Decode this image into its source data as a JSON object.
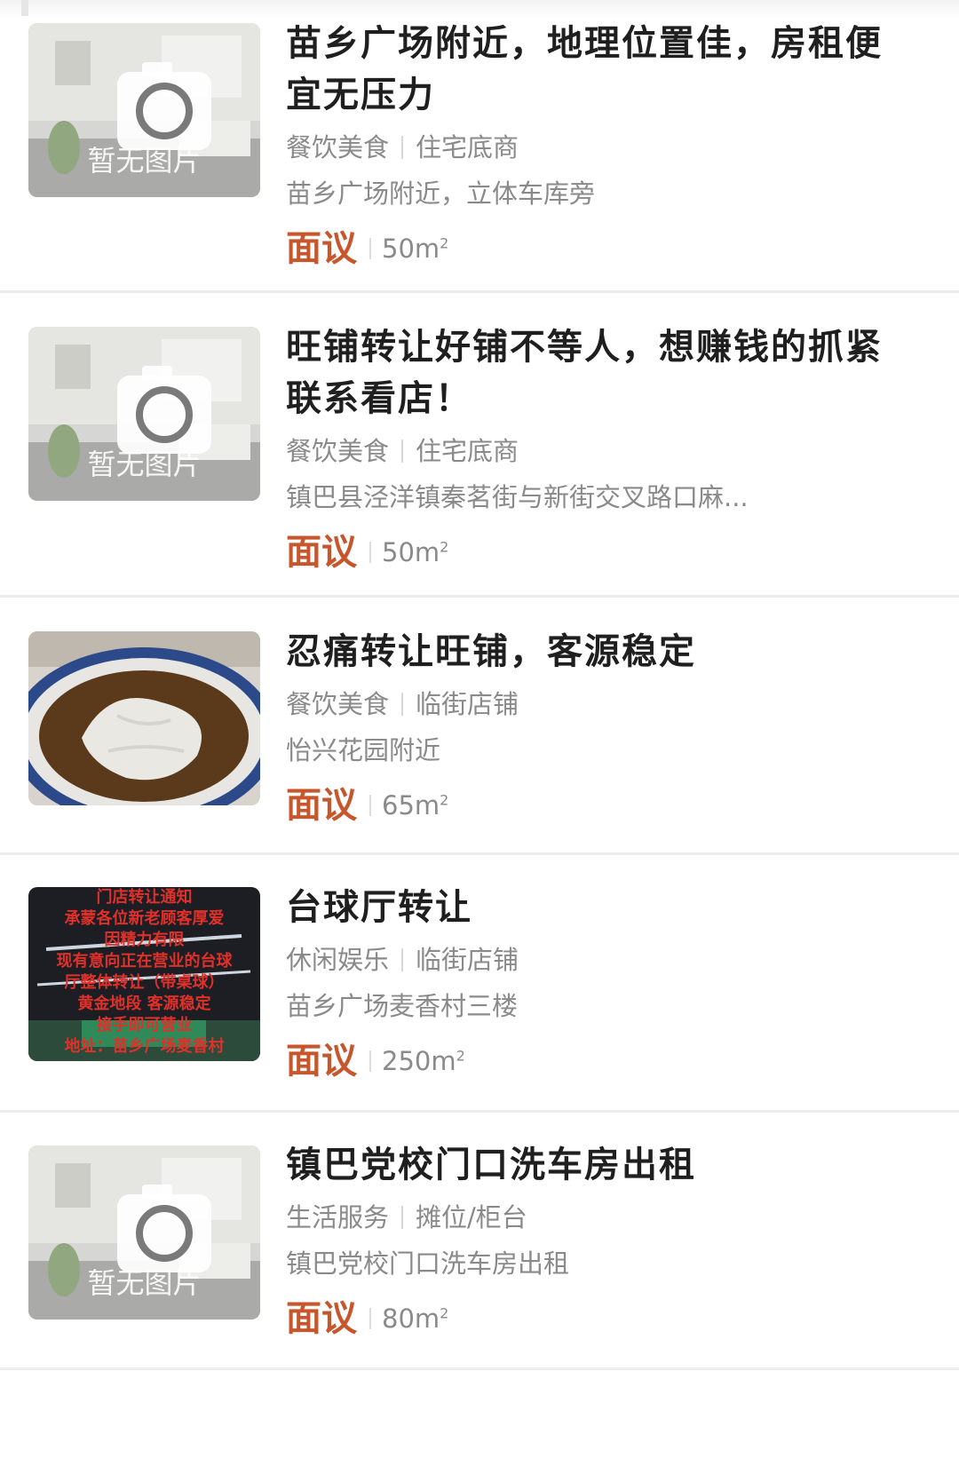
{
  "listings": [
    {
      "title": "苗乡广场附近，地理位置佳，房租便宜无压力",
      "title_line1": "苗乡广场附近，地理位置佳，房租便",
      "title_line2": "宜无压力",
      "category": "餐饮美食",
      "shop_type": "住宅底商",
      "address": "苗乡广场附近，立体车库旁",
      "price": "面议",
      "area_value": "50m",
      "area_sup": "2",
      "image": {
        "kind": "placeholder",
        "text": "暂无图片",
        "icon": "camera-icon"
      }
    },
    {
      "title": "旺铺转让好铺不等人，想赚钱的抓紧联系看店！",
      "title_line1": "旺铺转让好铺不等人，想赚钱的抓紧",
      "title_line2": "联系看店！",
      "category": "餐饮美食",
      "shop_type": "住宅底商",
      "address": "镇巴县泾洋镇秦茗街与新街交叉路口麻...",
      "price": "面议",
      "area_value": "50m",
      "area_sup": "2",
      "image": {
        "kind": "placeholder",
        "text": "暂无图片",
        "icon": "camera-icon"
      }
    },
    {
      "title": "忍痛转让旺铺，客源稳定",
      "category": "餐饮美食",
      "shop_type": "临街店铺",
      "address": "怡兴花园附近",
      "price": "面议",
      "area_value": "65m",
      "area_sup": "2",
      "image": {
        "kind": "photo",
        "subject": "food-bowl"
      }
    },
    {
      "title": "台球厅转让",
      "category": "休闲娱乐",
      "shop_type": "临街店铺",
      "address": "苗乡广场麦香村三楼",
      "price": "面议",
      "area_value": "250m",
      "area_sup": "2",
      "image": {
        "kind": "photo",
        "subject": "billiard-hall-notice",
        "overlay_lines": [
          "门店转让通知",
          "承蒙各位新老顾客厚爱",
          "因精力有限",
          "现有意向正在营业的台球",
          "厅整体转让（带桌球）",
          "黄金地段 客源稳定",
          "接手即可营业",
          "地址：苗乡广场麦香村"
        ]
      }
    },
    {
      "title": "镇巴党校门口洗车房出租",
      "category": "生活服务",
      "shop_type": "摊位/柜台",
      "address": "镇巴党校门口洗车房出租",
      "price": "面议",
      "area_value": "80m",
      "area_sup": "2",
      "image": {
        "kind": "placeholder",
        "text": "暂无图片",
        "icon": "camera-icon"
      }
    }
  ],
  "colors": {
    "price": "#c8562c",
    "meta_text": "#8a8a8a",
    "title_text": "#1f1f1f",
    "divider": "#ececec"
  }
}
